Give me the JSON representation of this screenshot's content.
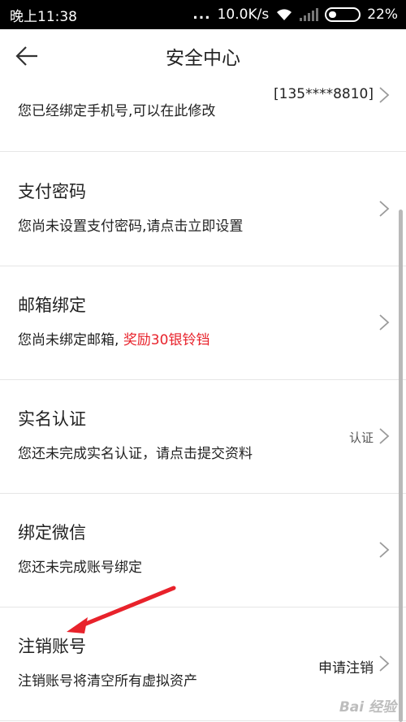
{
  "status": {
    "time": "晚上11:38",
    "dots": "...",
    "speed": "10.0K/s",
    "battery": "22%"
  },
  "nav": {
    "title": "安全中心"
  },
  "rows": [
    {
      "title": "",
      "subtitle": "您已经绑定手机号,可以在此修改",
      "value": "[135****8810]"
    },
    {
      "title": "支付密码",
      "subtitle": "您尚未设置支付密码,请点击立即设置",
      "value": ""
    },
    {
      "title": "邮箱绑定",
      "subtitle": "您尚未绑定邮箱, ",
      "subtitle_red": "奖励30银铃铛",
      "value": ""
    },
    {
      "title": "实名认证",
      "subtitle": "您还未完成实名认证，请点击提交资料",
      "value": "认证"
    },
    {
      "title": "绑定微信",
      "subtitle": "您还未完成账号绑定",
      "value": ""
    },
    {
      "title": "注销账号",
      "subtitle": "注销账号将清空所有虚拟资产",
      "value": "申请注销"
    }
  ],
  "watermark": "Bai 经验",
  "colors": {
    "accent_red": "#e8222b",
    "arrow_red": "#e8222b",
    "divider": "#e6e6e6"
  },
  "icons": {
    "back": "arrow-left-icon",
    "chevron": "chevron-right-icon"
  }
}
